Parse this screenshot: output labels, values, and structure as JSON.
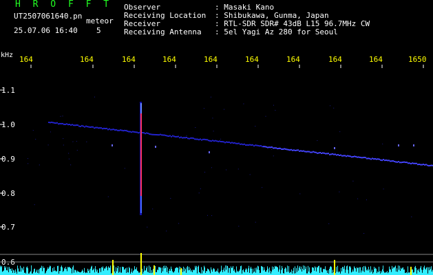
{
  "header": {
    "title": "H R O F F T",
    "filename": "UT2507061640.pn",
    "type_label": "meteor",
    "datetime": "25.07.06 16:40",
    "number": "5"
  },
  "info": [
    {
      "label": "Observer",
      "value": ": Masaki Kano"
    },
    {
      "label": "Receiving Location",
      "value": ": Shibukawa, Gunma, Japan"
    },
    {
      "label": "Receiver",
      "value": ": RTL-SDR SDR# 43dB L15 96.7MHz CW"
    },
    {
      "label": "Receiving Antenna",
      "value": ": 5el Yagi Az 280 for Seoul"
    }
  ],
  "axis": {
    "y_unit": "kHz",
    "x_ticks": [
      "164",
      "164",
      "164",
      "164",
      "164",
      "164",
      "164",
      "164",
      "164",
      "1650"
    ],
    "y_ticks": [
      "1.1",
      "1.0",
      "0.9",
      "0.8",
      "0.7",
      "0.6"
    ]
  },
  "colors": {
    "background": "#000000",
    "title": "#22ff22",
    "text": "#ffffff",
    "ticks": "#ffff00",
    "trace": "#3333ff",
    "meteor": "#ff3366",
    "spectrum": "#33eeff"
  }
}
